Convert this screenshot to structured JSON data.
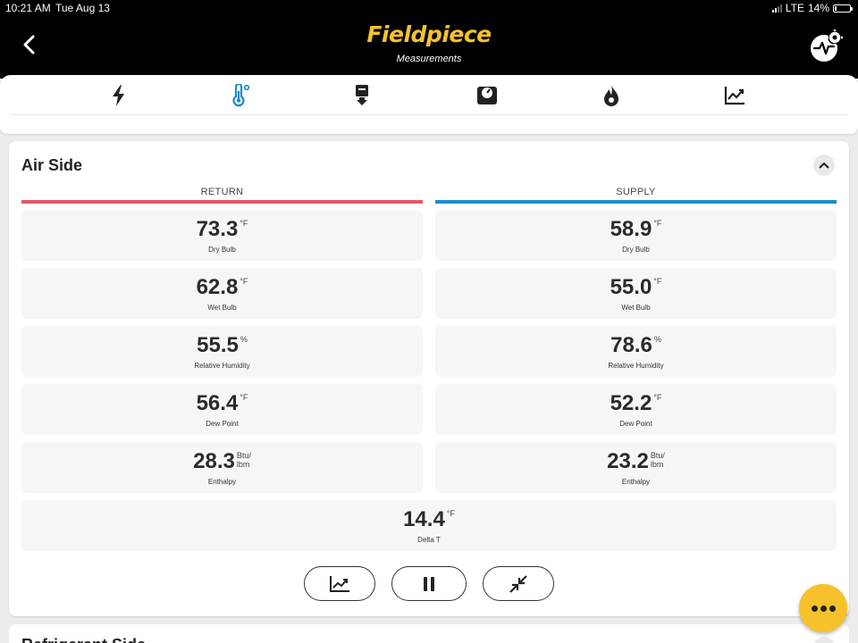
{
  "status_bar": {
    "time": "10:21 AM",
    "date": "Tue Aug 13",
    "network": "LTE",
    "battery": "14%",
    "battery_level": 0.14
  },
  "header": {
    "back_icon": "chevron-left-icon",
    "logo": "Fieldpiece",
    "subtitle": "Measurements",
    "settings_icon": "activity-settings-icon"
  },
  "tabs": [
    {
      "icon": "lightning-icon",
      "active": false
    },
    {
      "icon": "thermometer-icon",
      "active": true
    },
    {
      "icon": "vacuum-probe-icon",
      "active": false
    },
    {
      "icon": "refrigerant-scale-icon",
      "active": false
    },
    {
      "icon": "flame-icon",
      "active": false
    },
    {
      "icon": "trend-chart-icon",
      "active": false
    }
  ],
  "colors": {
    "accent": "#f5c22b",
    "active_tab": "#1e88c8",
    "return": "#e15a64",
    "supply": "#1e8ccc",
    "fab": "#f7c12c"
  },
  "air_side": {
    "title": "Air Side",
    "collapse_icon": "chevron-up-icon",
    "return_label": "RETURN",
    "supply_label": "SUPPLY",
    "return": [
      {
        "value": "73.3",
        "unit": "°F",
        "label": "Dry Bulb"
      },
      {
        "value": "62.8",
        "unit": "°F",
        "label": "Wet Bulb"
      },
      {
        "value": "55.5",
        "unit": "%",
        "label": "Relative Humidity"
      },
      {
        "value": "56.4",
        "unit": "°F",
        "label": "Dew Point"
      },
      {
        "value": "28.3",
        "unit": "Btu/\nlbm",
        "label": "Enthalpy"
      }
    ],
    "supply": [
      {
        "value": "58.9",
        "unit": "°F",
        "label": "Dry Bulb"
      },
      {
        "value": "55.0",
        "unit": "°F",
        "label": "Wet Bulb"
      },
      {
        "value": "78.6",
        "unit": "%",
        "label": "Relative Humidity"
      },
      {
        "value": "52.2",
        "unit": "°F",
        "label": "Dew Point"
      },
      {
        "value": "23.2",
        "unit": "Btu/\nlbm",
        "label": "Enthalpy"
      }
    ],
    "delta_t": {
      "value": "14.4",
      "unit": "°F",
      "label": "Delta T"
    },
    "actions": [
      "trend-chart-icon",
      "pause-icon",
      "collapse-arrows-icon"
    ]
  },
  "next_section": {
    "title": "Refrigerant Side"
  },
  "fab": {
    "icon": "more-dots-icon"
  }
}
